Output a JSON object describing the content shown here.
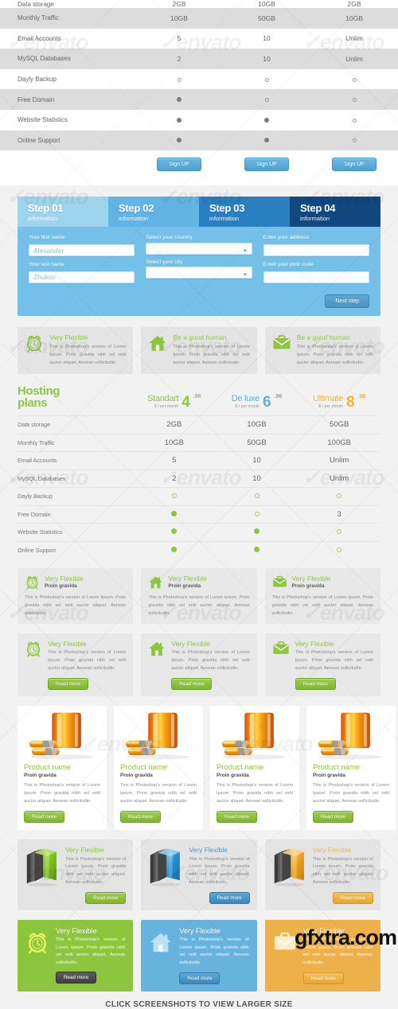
{
  "top_table": {
    "rows": [
      {
        "label": "Data storage",
        "values": [
          "2GB",
          "10GB",
          "2GB"
        ],
        "type": "text",
        "alt": false,
        "clipped": true
      },
      {
        "label": "Monthly Traffic",
        "values": [
          "10GB",
          "50GB",
          "10GB"
        ],
        "type": "text",
        "alt": true
      },
      {
        "label": "Email Accounts",
        "values": [
          "5",
          "10",
          "Unlim"
        ],
        "type": "text",
        "alt": false
      },
      {
        "label": "MySQL Databases",
        "values": [
          "2",
          "10",
          "Unlim"
        ],
        "type": "text",
        "alt": true
      },
      {
        "label": "Dayly Backup",
        "values": [
          "open",
          "open",
          "open"
        ],
        "type": "dot",
        "alt": false
      },
      {
        "label": "Free Domain",
        "values": [
          "solid",
          "open",
          "open"
        ],
        "type": "dot",
        "alt": true
      },
      {
        "label": "Website Statistics",
        "values": [
          "solid",
          "solid",
          "open"
        ],
        "type": "dot",
        "alt": false
      },
      {
        "label": "Online Support",
        "values": [
          "solid",
          "solid",
          "open"
        ],
        "type": "dot",
        "alt": true
      }
    ],
    "signup_label": "Sign UP"
  },
  "wizard": {
    "steps": [
      {
        "title": "Step 01",
        "sub": "information"
      },
      {
        "title": "Step 02",
        "sub": "information"
      },
      {
        "title": "Step 03",
        "sub": "information"
      },
      {
        "title": "Step 04",
        "sub": "information"
      }
    ],
    "fields": {
      "first_name_label": "Your first name",
      "first_name_value": "Alexander",
      "last_name_label": "Your last name",
      "last_name_value": "Zhukov",
      "country_label": "Select your country",
      "country_value": "",
      "city_label": "Select your city",
      "city_value": "",
      "address_label": "Enter your address",
      "address_value": "",
      "postcode_label": "Enter your post code",
      "postcode_value": ""
    },
    "next_label": "Next step"
  },
  "top_cards": [
    {
      "icon": "alarm-clock-icon",
      "title": "Very Flexible",
      "body": "This is Photoshop's version  of Lorem Ipsum. Proin gravida nibh vel velit auctor aliquet. Aenean sollicitudin."
    },
    {
      "icon": "home-icon",
      "title": "Be a good human",
      "body": "This is Photoshop's version  of Lorem Ipsum. Proin gravida nibh vel velit auctor aliquet. Aenean sollicitudin."
    },
    {
      "icon": "briefcase-icon",
      "title": "Be a good human",
      "body": "This is Photoshop's version  of Lorem Ipsum. Proin gravida nibh vel velit auctor aliquet. Aenean sollicitudin."
    }
  ],
  "plans": {
    "title_line1": "Hosting",
    "title_line2": "plans",
    "columns": [
      {
        "name": "Standart",
        "per": "$ / per month",
        "price": "4",
        "cents": ".96",
        "color": "#8ec640"
      },
      {
        "name": "De luxe",
        "per": "$ / per month",
        "price": "6",
        "cents": ".96",
        "color": "#55b3e3"
      },
      {
        "name": "Ultimate",
        "per": "$ / per month",
        "price": "8",
        "cents": ".96",
        "color": "#f0b341"
      }
    ],
    "rows": [
      {
        "label": "Data storage",
        "values": [
          "2GB",
          "10GB",
          "50GB"
        ],
        "type": "text"
      },
      {
        "label": "Monthly Traffic",
        "values": [
          "10GB",
          "50GB",
          "100GB"
        ],
        "type": "text"
      },
      {
        "label": "Email Accounts",
        "values": [
          "5",
          "10",
          "Unlim"
        ],
        "type": "text"
      },
      {
        "label": "MySQL Databases",
        "values": [
          "2",
          "10",
          "Unlim"
        ],
        "type": "text"
      },
      {
        "label": "Dayly Backup",
        "values": [
          "off",
          "off",
          "off"
        ],
        "type": "dot"
      },
      {
        "label": "Free Domain",
        "values": [
          "on",
          "off",
          "3"
        ],
        "type": "mixed"
      },
      {
        "label": "Website Statistics",
        "values": [
          "on",
          "on",
          "off"
        ],
        "type": "dot"
      },
      {
        "label": "Online Support",
        "values": [
          "on",
          "on",
          "off"
        ],
        "type": "dot"
      }
    ]
  },
  "feature_row_1": [
    {
      "icon": "alarm-clock-icon",
      "title": "Very Flexible",
      "sub": "Proin gravida",
      "body": "This is Photoshop's version  of Lorem Ipsum. Proin gravida nibh vel velit auctor aliquet. Aenean sollicitudin."
    },
    {
      "icon": "home-icon",
      "title": "Very Flexible",
      "sub": "Proin gravida",
      "body": "This is Photoshop's version  of Lorem Ipsum. Proin gravida nibh vel velit auctor aliquet. Aenean sollicitudin."
    },
    {
      "icon": "briefcase-icon",
      "title": "Very Flexible",
      "sub": "Proin gravida",
      "body": "This is Photoshop's version  of Lorem Ipsum. Proin gravida nibh vel velit auctor aliquet. Aenean sollicitudin."
    }
  ],
  "feature_row_2": [
    {
      "icon": "alarm-clock-icon",
      "title": "Very Flexible",
      "body": "This is Photoshop's version of Lorem Ipsum. Proin gravida nibh vel velit auctor aliquet. Aenean sollicitudin.",
      "button": "Read more"
    },
    {
      "icon": "home-icon",
      "title": "Very Flexible",
      "body": "This is Photoshop's version of Lorem Ipsum. Proin gravida nibh vel velit auctor aliquet. Aenean sollicitudin.",
      "button": "Read more"
    },
    {
      "icon": "briefcase-icon",
      "title": "Very Flexible",
      "body": "This is Photoshop's version of Lorem Ipsum. Proin gravida nibh vel velit auctor aliquet. Aenean sollicitudin.",
      "button": "Read more"
    }
  ],
  "products": [
    {
      "image": "battery-pack-image",
      "title": "Product name",
      "sub": "Proin gravida",
      "body": "This is Photoshop's version  of Lorem Ipsum. Proin gravida nibh vel velit auctor aliquet. Aenean sollicitudin.",
      "button": "Read more"
    },
    {
      "image": "battery-pack-image",
      "title": "Product name",
      "sub": "Proin gravida",
      "body": "This is Photoshop's version  of Lorem Ipsum. Proin gravida nibh vel velit auctor aliquet. Aenean sollicitudin.",
      "button": "Read more"
    },
    {
      "image": "battery-pack-image",
      "title": "Product name",
      "sub": "Proin gravida",
      "body": "This is Photoshop's version  of Lorem Ipsum. Proin gravida nibh vel velit auctor aliquet. Aenean sollicitudin.",
      "button": "Read more"
    },
    {
      "image": "battery-pack-image",
      "title": "Product name",
      "sub": "Proin gravida",
      "body": "This is Photoshop's version  of Lorem Ipsum. Proin gravida nibh vel velit auctor aliquet. Aenean sollicitudin.",
      "button": "Read more"
    }
  ],
  "box_cards": [
    {
      "image": "software-box-green-image",
      "title": "Very Flexible",
      "color": "#8ec640",
      "body": "This is Photoshop's version of Lorem Ipsum. Proin gravida nibh vel velit auctor aliquet. Aenean sollicitudin.",
      "button": "Read more",
      "button_style": "green"
    },
    {
      "image": "software-box-blue-image",
      "title": "Very Flexible",
      "color": "#4b96cc",
      "body": "This is Photoshop's version of Lorem Ipsum. Proin gravida nibh vel velit auctor aliquet. Aenean sollicitudin.",
      "button": "Read more",
      "button_style": "blue"
    },
    {
      "image": "software-box-orange-image",
      "title": "Very Flexible",
      "color": "#efb54c",
      "body": "This is Photoshop's version of Lorem Ipsum. Proin gravida nibh vel velit auctor aliquet. Aenean sollicitudin.",
      "button": "Read more",
      "button_style": "orange"
    }
  ],
  "color_cards": [
    {
      "icon": "alarm-clock-icon",
      "title": "Very Flexible",
      "bg": "#8cc63f",
      "body": "This is Photoshop's version of Lorem Ipsum. Proin gravida nibh vel velit auctor aliquet. Aenean sollicitudin.",
      "button": "Read more",
      "button_style": "dark"
    },
    {
      "icon": "home-icon",
      "title": "Very Flexible",
      "bg": "#66b3dd",
      "body": "This is Photoshop's version of Lorem Ipsum. Proin gravida nibh vel velit auctor aliquet. Aenean sollicitudin.",
      "button": "Read more",
      "button_style": "blue"
    },
    {
      "icon": "briefcase-icon",
      "title": "Very Flexible",
      "bg": "#eeb14a",
      "body": "This is Photoshop's version of Lorem Ipsum. Proin gravida nibh vel velit auctor aliquet. Aenean sollicitudin.",
      "button": "Read more",
      "button_style": "orange"
    }
  ],
  "footer": {
    "caption": "CLICK SCREENSHOTS TO VIEW LARGER SIZE",
    "watermark": "gfxtra.com"
  }
}
